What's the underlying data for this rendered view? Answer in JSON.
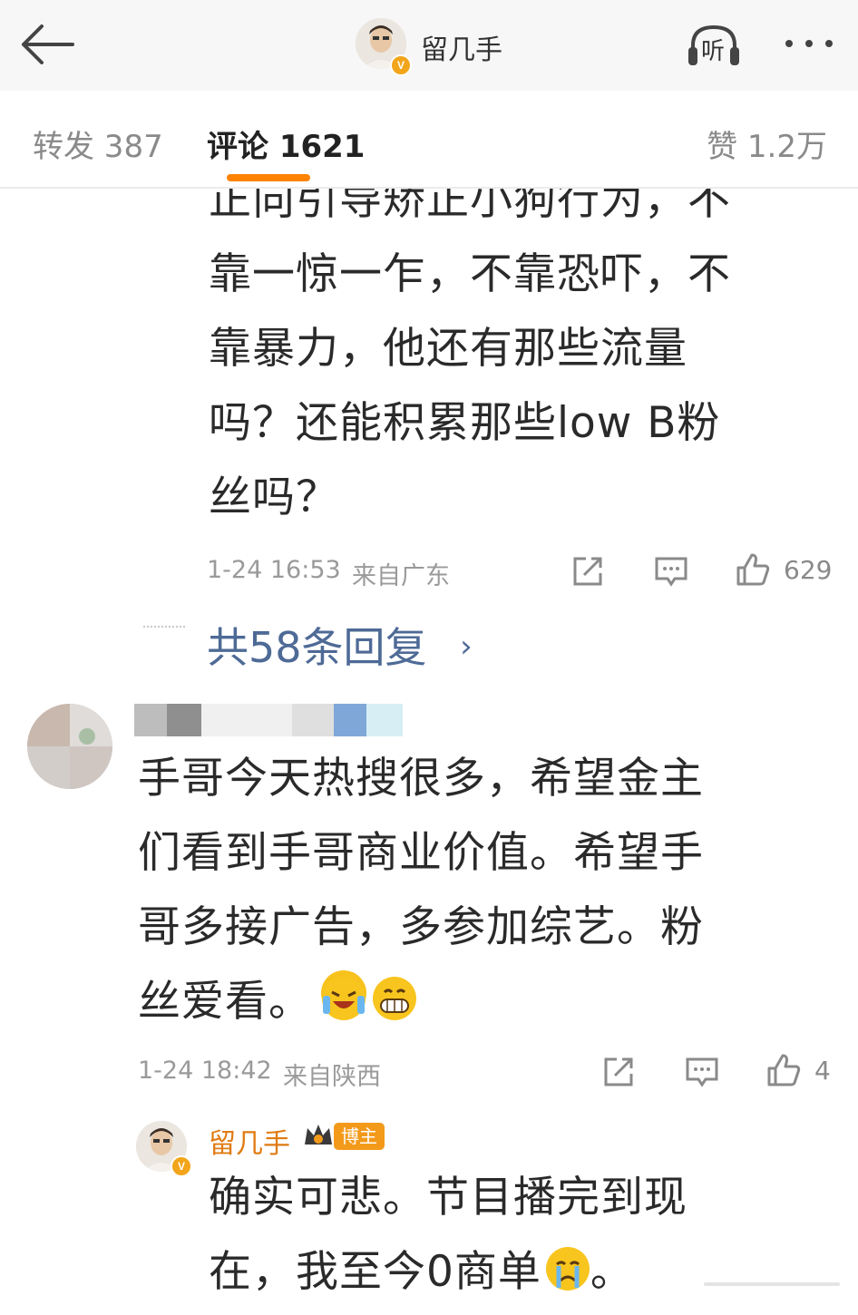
{
  "header": {
    "title": "留几手",
    "verified_badge": "V",
    "listen_label": "听",
    "icons": [
      "back-arrow-icon",
      "listen-headphones-icon",
      "more-icon"
    ]
  },
  "tabs": {
    "forward": "转发 387",
    "comments": "评论 1621",
    "likes": "赞 1.2万",
    "active": "comments",
    "accent_color": "#ff8200"
  },
  "comment1": {
    "lines": [
      "正向引导矫正小狗行为，不",
      "靠一惊一乍，不靠恐吓，不",
      "靠暴力，他还有那些流量",
      "吗？还能积累那些low B粉",
      "丝吗？"
    ],
    "time": "1-24 16:53",
    "location": "来自广东",
    "likes": "629",
    "replies_link": "共58条回复",
    "replies_chevron": "›"
  },
  "comment2": {
    "lines": [
      "手哥今天热搜很多，希望金主",
      "们看到手哥商业价值。希望手",
      "哥多接广告，多参加综艺。粉",
      "丝爱看。"
    ],
    "emojis": [
      "crying-laugh-emoji",
      "grin-emoji"
    ],
    "time": "1-24 18:42",
    "location": "来自陕西",
    "likes": "4"
  },
  "reply": {
    "author": "留几手",
    "badge": "博主",
    "lines": [
      "确实可悲。节目播完到现",
      "在，我至今0商单"
    ],
    "trailing": "。",
    "emoji": "crying-emoji"
  },
  "colors": {
    "link": "#4e6a96",
    "author": "#e07b12",
    "meta": "#9a9a9a"
  }
}
